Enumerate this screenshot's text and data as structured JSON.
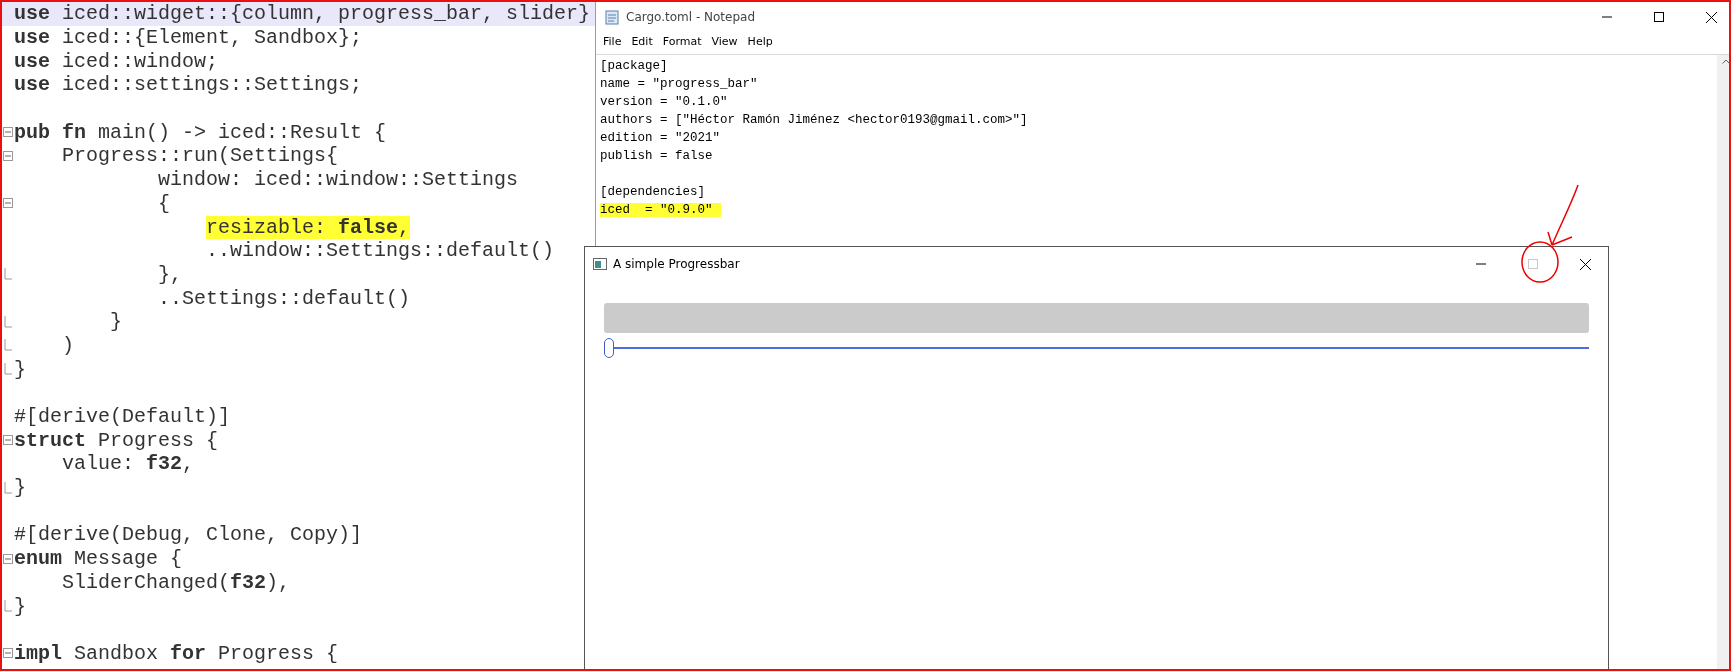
{
  "editor": {
    "lines": [
      {
        "kind": "code",
        "text": "**use** iced::widget::{column, progress_bar, slider}",
        "current": true
      },
      {
        "kind": "code",
        "text": "**use** iced::{Element, Sandbox};"
      },
      {
        "kind": "code",
        "text": "**use** iced::window;"
      },
      {
        "kind": "code",
        "text": "**use** iced::settings::Settings;"
      },
      {
        "kind": "blank"
      },
      {
        "kind": "code",
        "text": "**pub** **fn** main() -> iced::Result {",
        "fold_start": true
      },
      {
        "kind": "code",
        "text": "    Progress::run(Settings{",
        "fold_start": true
      },
      {
        "kind": "code",
        "text": "            window: iced::window::Settings"
      },
      {
        "kind": "code",
        "text": "            {",
        "fold_start": true
      },
      {
        "kind": "code",
        "text": "                resizable: **false**,",
        "highlight": true
      },
      {
        "kind": "code",
        "text": "                ..window::Settings::default()"
      },
      {
        "kind": "code",
        "text": "            },",
        "fold_end": true
      },
      {
        "kind": "code",
        "text": "            ..Settings::default()"
      },
      {
        "kind": "code",
        "text": "        }",
        "fold_end": true
      },
      {
        "kind": "code",
        "text": "    )",
        "fold_end": true
      },
      {
        "kind": "code",
        "text": "}",
        "fold_end": true
      },
      {
        "kind": "blank"
      },
      {
        "kind": "code",
        "text": "#[derive(Default)]"
      },
      {
        "kind": "code",
        "text": "**struct** Progress {",
        "fold_start": true
      },
      {
        "kind": "code",
        "text": "    value: **f32**,"
      },
      {
        "kind": "code",
        "text": "}",
        "fold_end": true
      },
      {
        "kind": "blank"
      },
      {
        "kind": "code",
        "text": "#[derive(Debug, Clone, Copy)]"
      },
      {
        "kind": "code",
        "text": "**enum** Message {",
        "fold_start": true
      },
      {
        "kind": "code",
        "text": "    SliderChanged(**f32**),"
      },
      {
        "kind": "code",
        "text": "}",
        "fold_end": true
      },
      {
        "kind": "blank"
      },
      {
        "kind": "code",
        "text": "**impl** Sandbox **for** Progress {",
        "fold_start": true
      }
    ]
  },
  "notepad": {
    "title": "Cargo.toml - Notepad",
    "menu": [
      "File",
      "Edit",
      "Format",
      "View",
      "Help"
    ],
    "sections": [
      {
        "lines": [
          {
            "text": "[package]"
          },
          {
            "text": "name = \"progress_bar\""
          },
          {
            "text": "version = \"0.1.0\""
          },
          {
            "text": "authors = [\"Héctor Ramón Jiménez <hector0193@gmail.com>\"]"
          },
          {
            "text": "edition = \"2021\""
          },
          {
            "text": "publish = false"
          }
        ]
      },
      {
        "lines": [
          {
            "text": "[dependencies]"
          },
          {
            "text": "iced  = \"0.9.0\"",
            "highlight": true
          }
        ]
      }
    ]
  },
  "app_window": {
    "title": "A simple Progressbar",
    "maximize_disabled": true,
    "progress": {
      "level": 0
    },
    "slider": {
      "level": 0
    }
  }
}
